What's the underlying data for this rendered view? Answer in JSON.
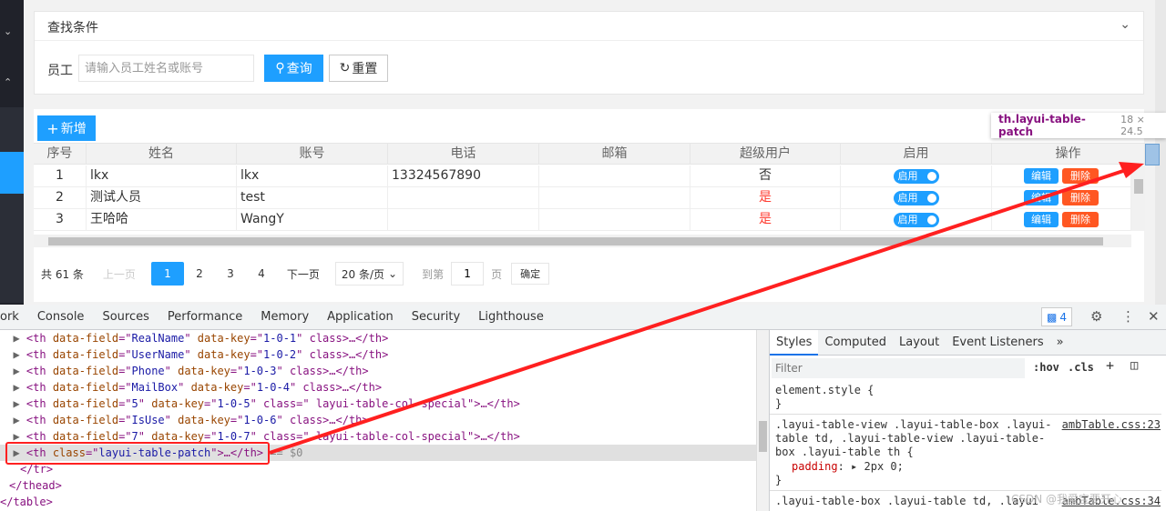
{
  "panel": {
    "title": "查找条件"
  },
  "search": {
    "label": "员工",
    "placeholder": "请输入员工姓名或账号",
    "search_label": "查询",
    "reset_label": "重置"
  },
  "toolbar": {
    "add_label": "新增"
  },
  "table": {
    "columns": [
      "序号",
      "姓名",
      "账号",
      "电话",
      "邮箱",
      "超级用户",
      "启用",
      "操作"
    ],
    "rows": [
      {
        "no": "1",
        "name": "lkx",
        "account": "lkx",
        "phone": "13324567890",
        "email": "",
        "super": "否",
        "toggle": "启用",
        "edit": "编辑",
        "del": "删除"
      },
      {
        "no": "2",
        "name": "测试人员",
        "account": "test",
        "phone": "",
        "email": "",
        "super": "是",
        "toggle": "启用",
        "edit": "编辑",
        "del": "删除"
      },
      {
        "no": "3",
        "name": "王哈哈",
        "account": "WangY",
        "phone": "",
        "email": "",
        "super": "是",
        "toggle": "启用",
        "edit": "编辑",
        "del": "删除"
      }
    ]
  },
  "pager": {
    "total": "共 61 条",
    "prev": "上一页",
    "pages": [
      "1",
      "2",
      "3",
      "4"
    ],
    "current": "1",
    "next": "下一页",
    "size": "20 条/页",
    "goto": "到第",
    "goto_value": "1",
    "page_unit": "页",
    "confirm": "确定"
  },
  "tooltip": {
    "selector": "th.layui-table-patch",
    "dims": "18 × 24.5"
  },
  "devtools": {
    "tabs": [
      "ork",
      "Console",
      "Sources",
      "Performance",
      "Memory",
      "Application",
      "Security",
      "Lighthouse"
    ],
    "issues_count": "4",
    "elements": [
      {
        "field": "RealName",
        "key": "1-0-1",
        "cls": "class>…</th>"
      },
      {
        "field": "UserName",
        "key": "1-0-2",
        "cls": "class>…</th>"
      },
      {
        "field": "Phone",
        "key": "1-0-3",
        "cls": "class>…</th>"
      },
      {
        "field": "MailBox",
        "key": "1-0-4",
        "cls": "class>…</th>"
      },
      {
        "field": "5",
        "key": "1-0-5",
        "cls": "class=\" layui-table-col-special\">…</th>"
      },
      {
        "field": "IsUse",
        "key": "1-0-6",
        "cls": "class>…</th>"
      },
      {
        "field": "7",
        "key": "1-0-7",
        "cls": "class=\" layui-table-col-special\">…</th>"
      }
    ],
    "selected_line": {
      "cls_value": "layui-table-patch",
      "marker": "== $0"
    },
    "close_tr": "</tr>",
    "close_thead": "</thead>",
    "close_table": "</table>",
    "styles_tabs": [
      "Styles",
      "Computed",
      "Layout",
      "Event Listeners",
      "»"
    ],
    "filter_placeholder": "Filter",
    "hov": ":hov",
    "cls": ".cls",
    "rule1": {
      "selector": "element.style {",
      "close": "}"
    },
    "rule2": {
      "selector": ".layui-table-view .layui-table-box .layui-\ntable td, .layui-table-view .layui-table-\nbox .layui-table th {",
      "source": "ambTable.css:23",
      "prop": "padding",
      "value": "2px 0;",
      "close": "}"
    },
    "rule3": {
      "selector": ".layui-table-box .layui-table td, .layui",
      "source": "ambTable.css:34"
    }
  },
  "watermark": "CSDN @我爱宝要开心",
  "colors": {
    "accent": "#1e9fff",
    "danger": "#ff5722",
    "annotation": "#ff2020"
  }
}
